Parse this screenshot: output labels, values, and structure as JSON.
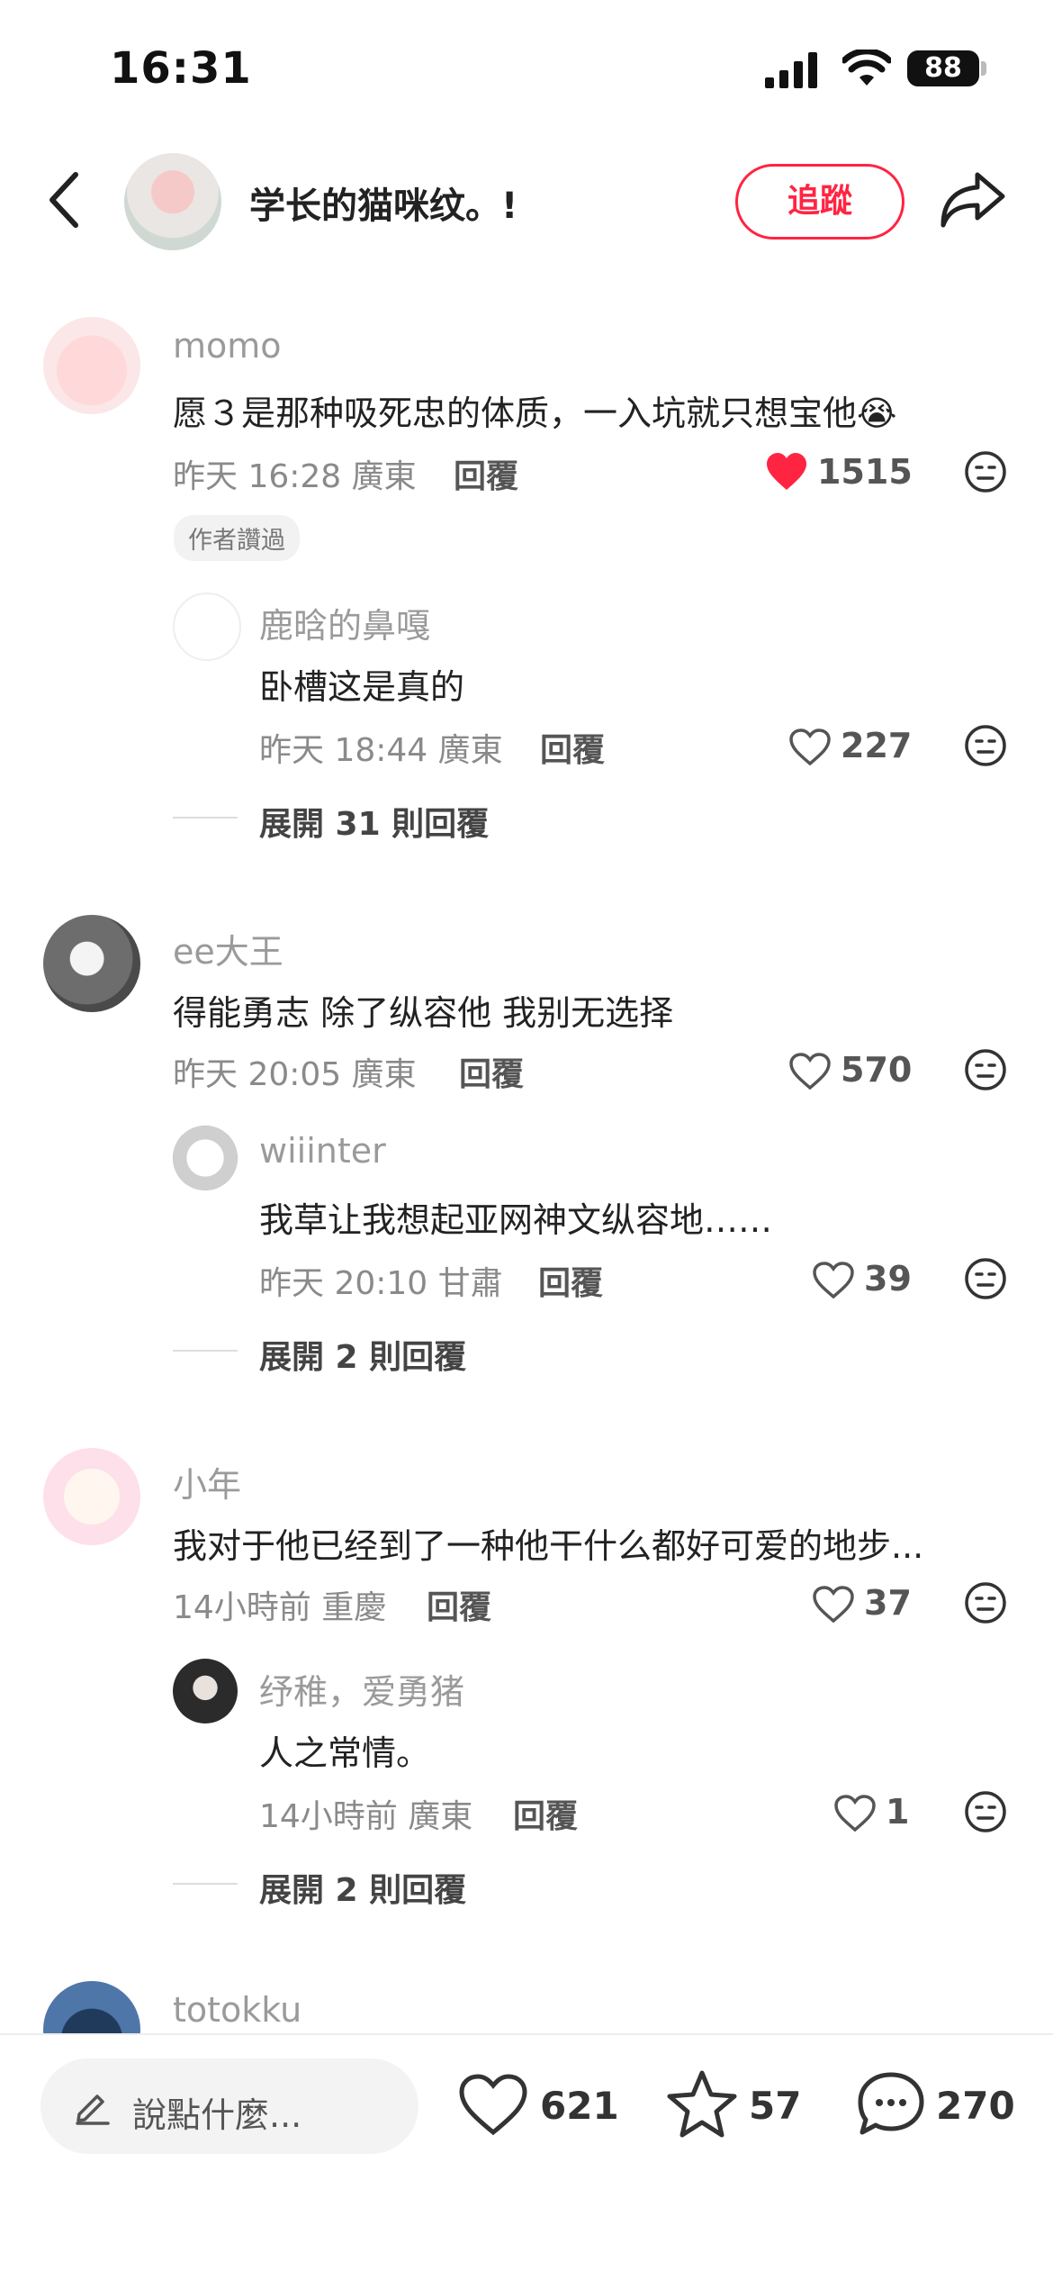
{
  "status_bar": {
    "time": "16:31",
    "battery": "88"
  },
  "header": {
    "title": "学长的猫咪纹。!",
    "follow_label": "追蹤"
  },
  "comments": [
    {
      "username": "momo",
      "text": "愿３是那种吸死忠的体质，一入坑就只想宝他😭",
      "meta": "昨天 16:28 廣東",
      "reply_label": "回覆",
      "likes": "1515",
      "liked": true,
      "badge": "作者讚過",
      "replies": [
        {
          "username": "鹿晗的鼻嘎",
          "text": "卧槽这是真的",
          "meta": "昨天 18:44 廣東",
          "reply_label": "回覆",
          "likes": "227"
        }
      ],
      "expand_label": "展開 31 則回覆"
    },
    {
      "username": "ee大王",
      "text": "得能勇志 除了纵容他 我别无选择",
      "meta": "昨天 20:05 廣東",
      "reply_label": "回覆",
      "likes": "570",
      "replies": [
        {
          "username": "wiiinter",
          "text": "我草让我想起亚网神文纵容地……",
          "meta": "昨天 20:10 甘肅",
          "reply_label": "回覆",
          "likes": "39"
        }
      ],
      "expand_label": "展開 2 則回覆"
    },
    {
      "username": "小年",
      "text": "我对于他已经到了一种他干什么都好可爱的地步...",
      "meta": "14小時前 重慶",
      "reply_label": "回覆",
      "likes": "37",
      "replies": [
        {
          "username": "纾稚，爱勇猪",
          "text": "人之常情。",
          "meta": "14小時前 廣東",
          "reply_label": "回覆",
          "likes": "1"
        }
      ],
      "expand_label": "展開 2 則回覆"
    },
    {
      "username": "totokku"
    }
  ],
  "bottom_bar": {
    "input_placeholder": "說點什麼...",
    "likes": "621",
    "favorites": "57",
    "comments": "270"
  },
  "colors": {
    "accent": "#ff2442",
    "liked_heart": "#ff2442"
  }
}
